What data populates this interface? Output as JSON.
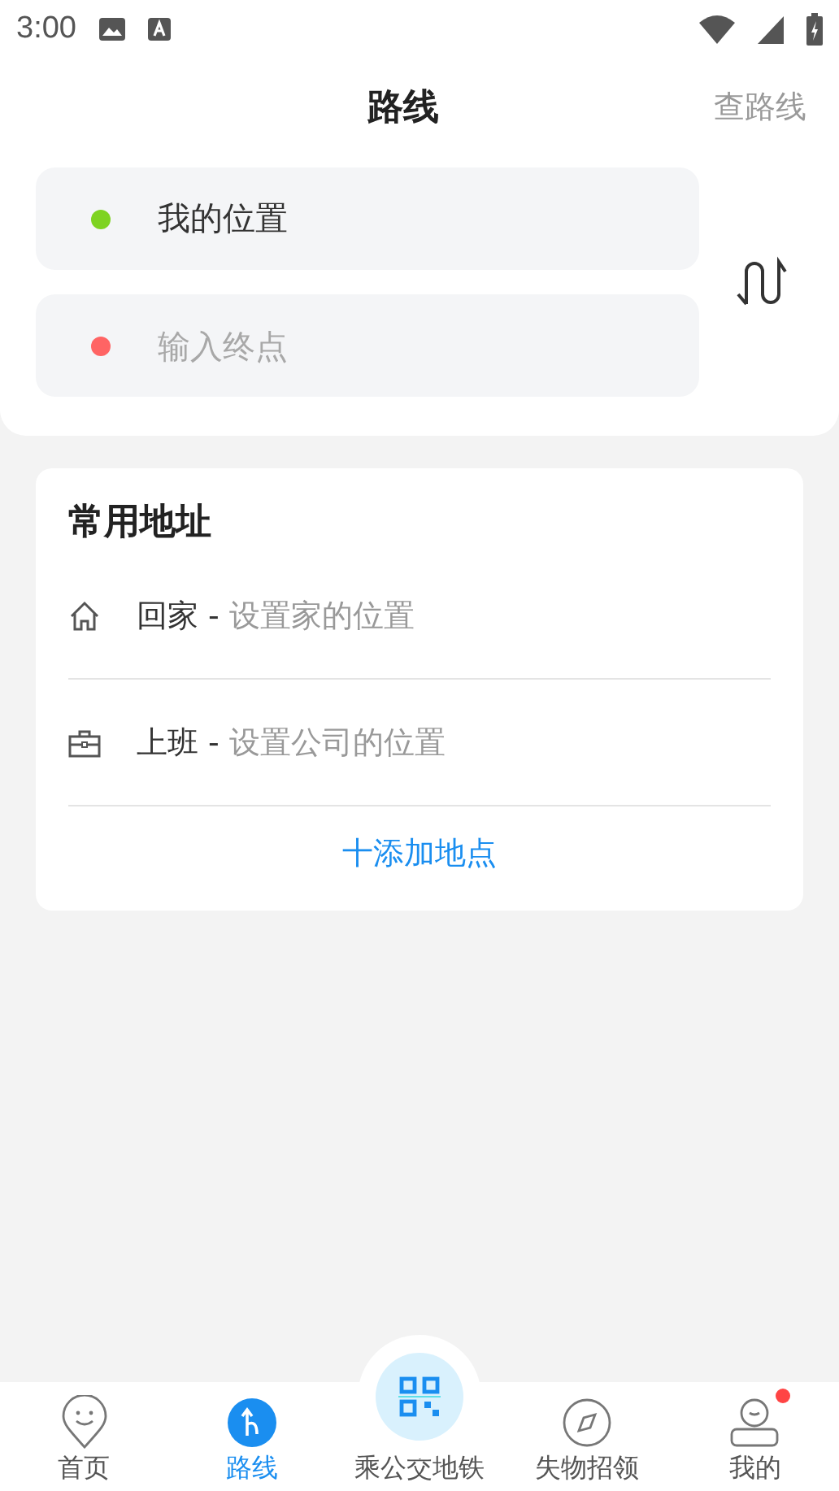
{
  "status_bar": {
    "time": "3:00"
  },
  "header": {
    "title": "路线",
    "action": "查路线"
  },
  "route_inputs": [
    {
      "value": "我的位置",
      "color": "#7ed321"
    },
    {
      "placeholder": "输入终点",
      "color": "#ff6464"
    }
  ],
  "common_addresses": {
    "title": "常用地址",
    "items": [
      {
        "kind": "home",
        "label": "回家 -",
        "hint": "设置家的位置"
      },
      {
        "kind": "work",
        "label": "上班 -",
        "hint": "设置公司的位置"
      }
    ],
    "add_button": "十添加地点"
  },
  "bottom_nav": [
    {
      "kind": "pin",
      "label": "首页",
      "selected": false,
      "badge": false
    },
    {
      "kind": "route",
      "label": "路线",
      "selected": true,
      "badge": false
    },
    {
      "kind": "qr",
      "label": "乘公交地铁",
      "selected": false,
      "badge": false
    },
    {
      "kind": "compass",
      "label": "失物招领",
      "selected": false,
      "badge": false
    },
    {
      "kind": "person",
      "label": "我的",
      "selected": false,
      "badge": true
    }
  ]
}
